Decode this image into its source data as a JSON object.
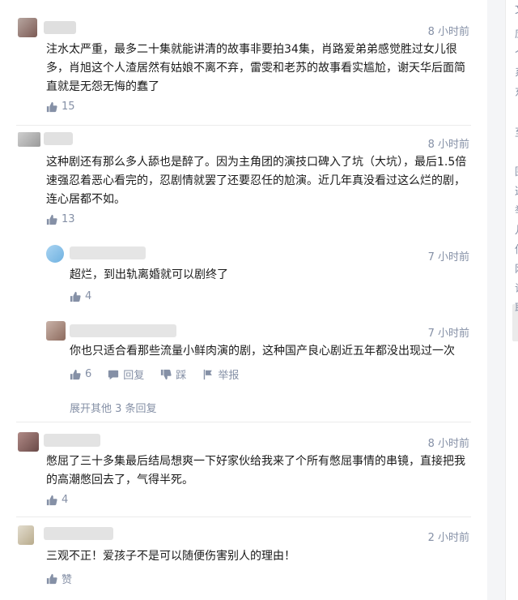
{
  "comments": [
    {
      "time": "8 小时前",
      "text": "注水太严重，最多二十集就能讲清的故事非要拍34集，肖路爱弟弟感觉胜过女儿很多，肖旭这个人渣居然有姑娘不离不弃，雷雯和老苏的故事看实尴尬，谢天华后面简直就是无怨无悔的蠢了",
      "likes": "15"
    },
    {
      "time": "8 小时前",
      "text": "这种剧还有那么多人舔也是醉了。因为主角团的演技口碑入了坑（大坑），最后1.5倍速强忍着恶心看完的，忍剧情就罢了还要忍任的尬演。近几年真没看过这么烂的剧，连心居都不如。",
      "likes": "13"
    },
    {
      "time": "8 小时前",
      "text": "憋屈了三十多集最后结局想爽一下好家伙给我来了个所有憋屈事情的串镜，直接把我的高潮憋回去了，气得半死。",
      "likes": "4"
    },
    {
      "time": "2 小时前",
      "text": "三观不正！爱孩子不是可以随便伤害别人的理由！",
      "likes": "赞"
    }
  ],
  "replies": [
    {
      "time": "7 小时前",
      "text": "超烂，到出轨离婚就可以剧终了",
      "likes": "4"
    },
    {
      "time": "7 小时前",
      "text": "你也只适合看那些流量小鲜肉演的剧，这种国产良心剧近五年都没出现过一次",
      "likes": "6",
      "reply_label": "回复",
      "dislike_label": "踩",
      "report_label": "举报"
    }
  ],
  "expand_label": "展开其他 3 条回复",
  "sidebar_glyphs": [
    "文",
    "应",
    "个",
    "系",
    "东",
    "至",
    "围",
    "这",
    "举",
    "儿",
    "侵",
    "网",
    "证",
    "耶"
  ],
  "icons": {
    "like": "thumb-up-icon",
    "reply": "reply-icon",
    "dislike": "thumb-down-icon",
    "report": "flag-icon"
  },
  "colors": {
    "meta": "#8590a6",
    "text": "#1a1a1a",
    "divider": "#ebebeb"
  }
}
